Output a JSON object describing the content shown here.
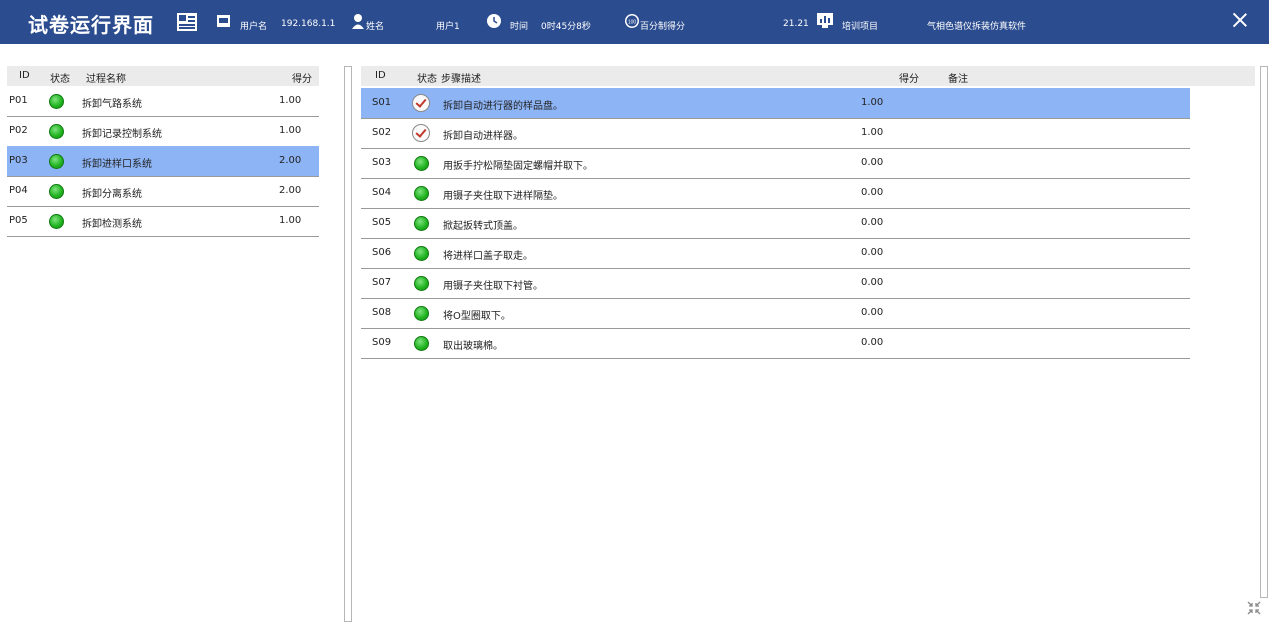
{
  "header": {
    "title": "试卷运行界面",
    "username_label": "用户名",
    "username_value": "192.168.1.1",
    "name_label": "姓名",
    "name_value": "用户1",
    "time_label": "时间",
    "time_value": "0时45分8秒",
    "score_badge": "100",
    "score_label": "百分制得分",
    "score_value": "21.21",
    "project_label": "培训项目",
    "project_value": "气相色谱仪拆装仿真软件"
  },
  "processes": {
    "columns": [
      "ID",
      "状态",
      "过程名称",
      "得分"
    ],
    "rows": [
      {
        "id": "P01",
        "name": "拆卸气路系统",
        "score": "1.00"
      },
      {
        "id": "P02",
        "name": "拆卸记录控制系统",
        "score": "1.00"
      },
      {
        "id": "P03",
        "name": "拆卸进样口系统",
        "score": "2.00"
      },
      {
        "id": "P04",
        "name": "拆卸分离系统",
        "score": "2.00"
      },
      {
        "id": "P05",
        "name": "拆卸检测系统",
        "score": "1.00"
      }
    ]
  },
  "steps": {
    "columns": [
      "ID",
      "状态",
      "步骤描述",
      "得分",
      "备注"
    ],
    "rows": [
      {
        "id": "S01",
        "desc": "拆卸自动进行器的样品盘。",
        "score": "1.00",
        "note": ""
      },
      {
        "id": "S02",
        "desc": "拆卸自动进样器。",
        "score": "1.00",
        "note": ""
      },
      {
        "id": "S03",
        "desc": "用扳手拧松隔垫固定螺帽并取下。",
        "score": "0.00",
        "note": ""
      },
      {
        "id": "S04",
        "desc": "用镊子夹住取下进样隔垫。",
        "score": "0.00",
        "note": ""
      },
      {
        "id": "S05",
        "desc": "掀起扳转式顶盖。",
        "score": "0.00",
        "note": ""
      },
      {
        "id": "S06",
        "desc": "将进样口盖子取走。",
        "score": "0.00",
        "note": ""
      },
      {
        "id": "S07",
        "desc": "用镊子夹住取下衬管。",
        "score": "0.00",
        "note": ""
      },
      {
        "id": "S08",
        "desc": "将O型圈取下。",
        "score": "0.00",
        "note": ""
      },
      {
        "id": "S09",
        "desc": "取出玻璃棉。",
        "score": "0.00",
        "note": ""
      }
    ]
  },
  "colors": {
    "topbar": "#2b4c8f",
    "selected_row": "#8db4f5",
    "status_green": "#23b523",
    "check_red": "#c0392b"
  }
}
